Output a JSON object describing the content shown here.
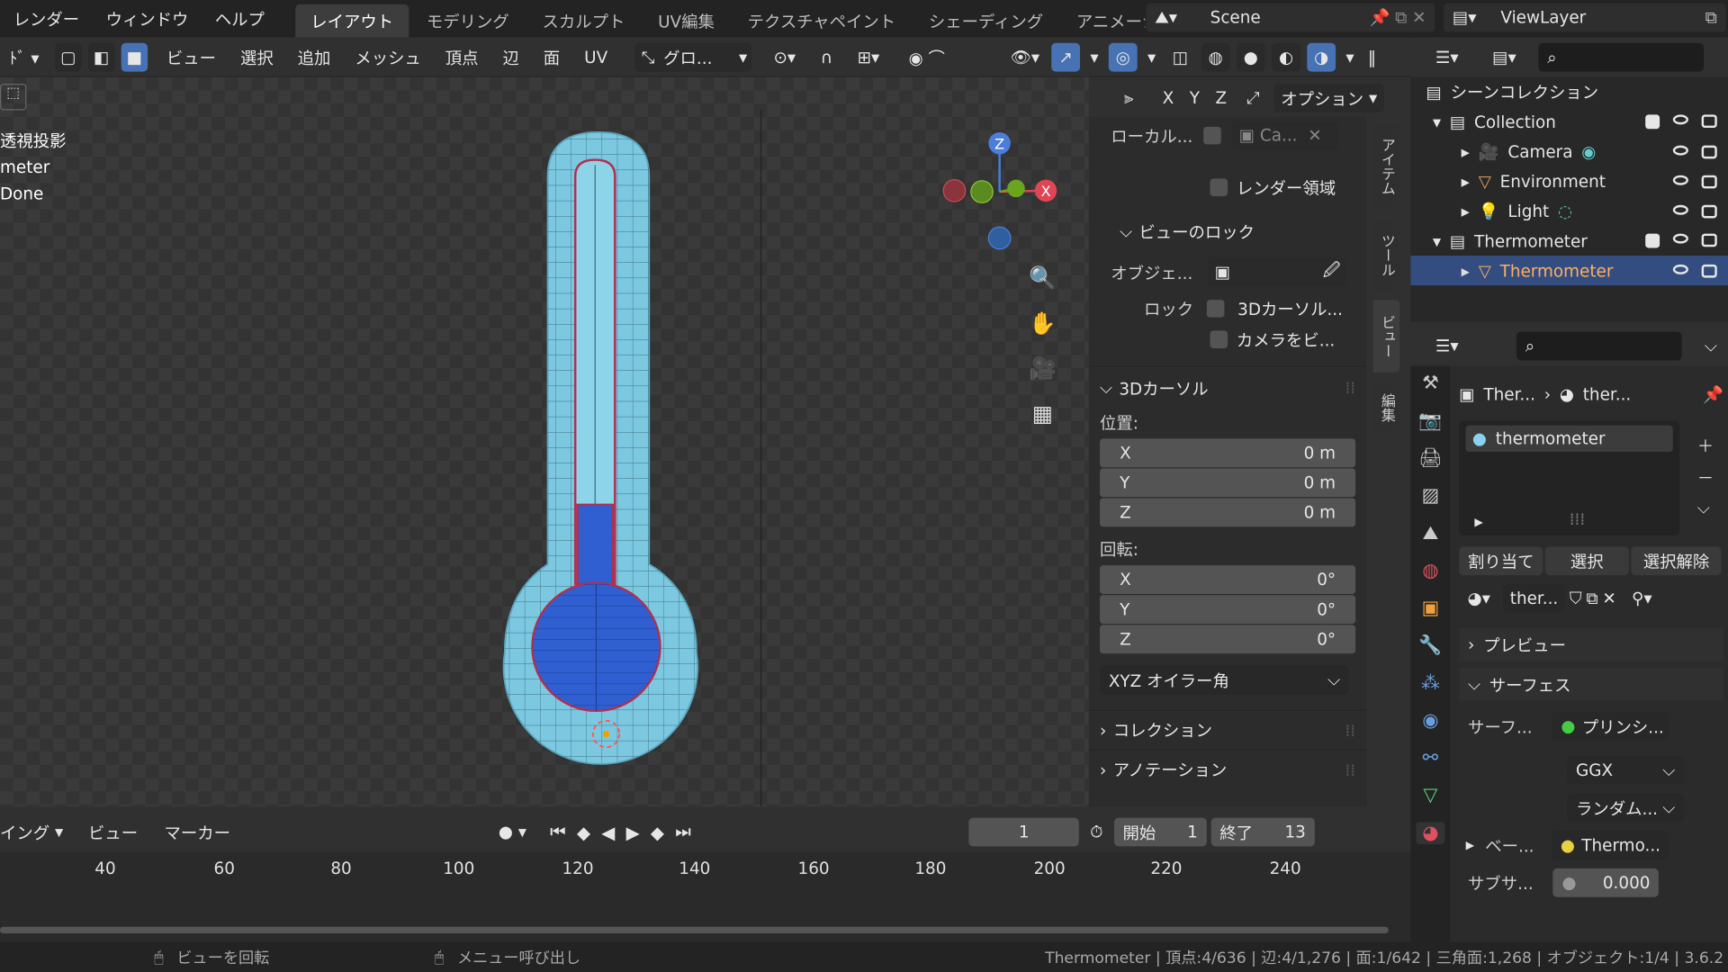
{
  "menu": [
    "レンダー",
    "ウィンドウ",
    "ヘルプ"
  ],
  "workspaces": [
    {
      "label": "レイアウト",
      "active": true
    },
    {
      "label": "モデリング"
    },
    {
      "label": "スカルプト"
    },
    {
      "label": "UV編集"
    },
    {
      "label": "テクスチャペイント"
    },
    {
      "label": "シェーディング"
    },
    {
      "label": "アニメーシ"
    }
  ],
  "scene": "Scene",
  "viewlayer": "ViewLayer",
  "vpmenu": [
    "ビュー",
    "選択",
    "追加",
    "メッシュ",
    "頂点",
    "辺",
    "面",
    "UV"
  ],
  "transform_orientation": "グロ...",
  "xyz": [
    "X",
    "Y",
    "Z"
  ],
  "options": "オプション",
  "overlay_text": [
    "透視投影",
    "meter",
    "Done"
  ],
  "npanel": {
    "local": "ローカル...",
    "local_cam": "Ca...",
    "render_region": "レンダー領域",
    "viewlock": "ビューのロック",
    "object": "オブジェ...",
    "lock": "ロック",
    "lock_cursor": "3Dカーソル...",
    "lock_camera": "カメラをビ...",
    "cursor": "3Dカーソル",
    "location": "位置:",
    "loc": [
      {
        "a": "X",
        "v": "0 m"
      },
      {
        "a": "Y",
        "v": "0 m"
      },
      {
        "a": "Z",
        "v": "0 m"
      }
    ],
    "rotation": "回転:",
    "rot": [
      {
        "a": "X",
        "v": "0°"
      },
      {
        "a": "Y",
        "v": "0°"
      },
      {
        "a": "Z",
        "v": "0°"
      }
    ],
    "rotmode": "XYZ オイラー角",
    "collection": "コレクション",
    "annotation": "アノテーション"
  },
  "vtabs": [
    "アイテム",
    "ツール",
    "ビュー",
    "編集"
  ],
  "gizmo": {
    "z": "Z",
    "x": "X"
  },
  "timeline": {
    "menus": [
      "イング",
      "ビュー",
      "マーカー"
    ],
    "current": "1",
    "start_label": "開始",
    "start": "1",
    "end_label": "終了",
    "end": "13",
    "ticks": [
      "40",
      "60",
      "80",
      "100",
      "120",
      "140",
      "160",
      "180",
      "200",
      "220",
      "240"
    ]
  },
  "outliner": {
    "root": "シーンコレクション",
    "items": [
      {
        "label": "Collection",
        "indent": 0
      },
      {
        "label": "Camera",
        "indent": 1
      },
      {
        "label": "Environment",
        "indent": 1
      },
      {
        "label": "Light",
        "indent": 1
      },
      {
        "label": "Thermometer",
        "indent": 0
      },
      {
        "label": "Thermometer",
        "indent": 1,
        "selected": true
      }
    ]
  },
  "props": {
    "crumb1": "Ther...",
    "crumb2": "ther...",
    "slot": "thermometer",
    "assign": "割り当て",
    "select": "選択",
    "deselect": "選択解除",
    "matname": "ther...",
    "preview": "プレビュー",
    "surface": "サーフェス",
    "surface_lbl": "サーフ...",
    "shader": "プリンシ...",
    "dist": "GGX",
    "sss": "ランダム...",
    "base_lbl": "ベー...",
    "base_val": "Thermo...",
    "sub_lbl": "サブサ...",
    "sub_val": "0.000"
  },
  "status": {
    "left1": "ビューを回転",
    "left2": "メニュー呼び出し",
    "right": "Thermometer | 頂点:4/636 | 辺:4/1,276 | 面:1/642 | 三角面:1,268 | オブジェクト:1/4 | 3.6.2"
  },
  "colors": {
    "accent": "#4772b3",
    "select": "#334d80",
    "liquid": "#2f5fd0",
    "glass": "#7cc8e0"
  }
}
